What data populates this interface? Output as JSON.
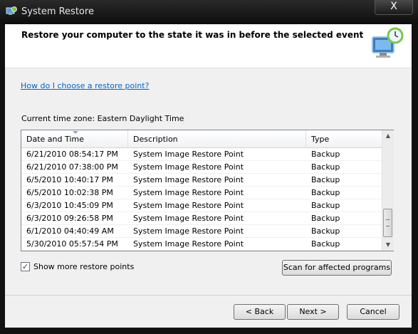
{
  "window": {
    "title": "System Restore",
    "close_label": "X"
  },
  "header": {
    "heading": "Restore your computer to the state it was in before the selected event"
  },
  "help_link": "How do I choose a restore point?",
  "timezone": "Current time zone: Eastern Daylight Time",
  "list": {
    "columns": [
      "Date and Time",
      "Description",
      "Type"
    ],
    "rows": [
      {
        "date": "6/21/2010 08:54:17 PM",
        "desc": "System Image Restore Point",
        "type": "Backup"
      },
      {
        "date": "6/21/2010 07:38:00 PM",
        "desc": "System Image Restore Point",
        "type": "Backup"
      },
      {
        "date": "6/5/2010 10:40:17 PM",
        "desc": "System Image Restore Point",
        "type": "Backup"
      },
      {
        "date": "6/5/2010 10:02:38 PM",
        "desc": "System Image Restore Point",
        "type": "Backup"
      },
      {
        "date": "6/3/2010 10:45:09 PM",
        "desc": "System Image Restore Point",
        "type": "Backup"
      },
      {
        "date": "6/3/2010 09:26:58 PM",
        "desc": "System Image Restore Point",
        "type": "Backup"
      },
      {
        "date": "6/1/2010 04:40:49 AM",
        "desc": "System Image Restore Point",
        "type": "Backup"
      },
      {
        "date": "5/30/2010 05:57:54 PM",
        "desc": "System Image Restore Point",
        "type": "Backup"
      }
    ],
    "scroll_up_glyph": "▲",
    "scroll_down_glyph": "▼"
  },
  "show_more": {
    "label": "Show more restore points",
    "checked": true,
    "check_glyph": "✓"
  },
  "buttons": {
    "scan": "Scan for affected programs",
    "back": "< Back",
    "next": "Next >",
    "cancel": "Cancel"
  },
  "icons": {
    "app": "system-restore-icon",
    "header": "restore-clock-monitor-icon"
  }
}
